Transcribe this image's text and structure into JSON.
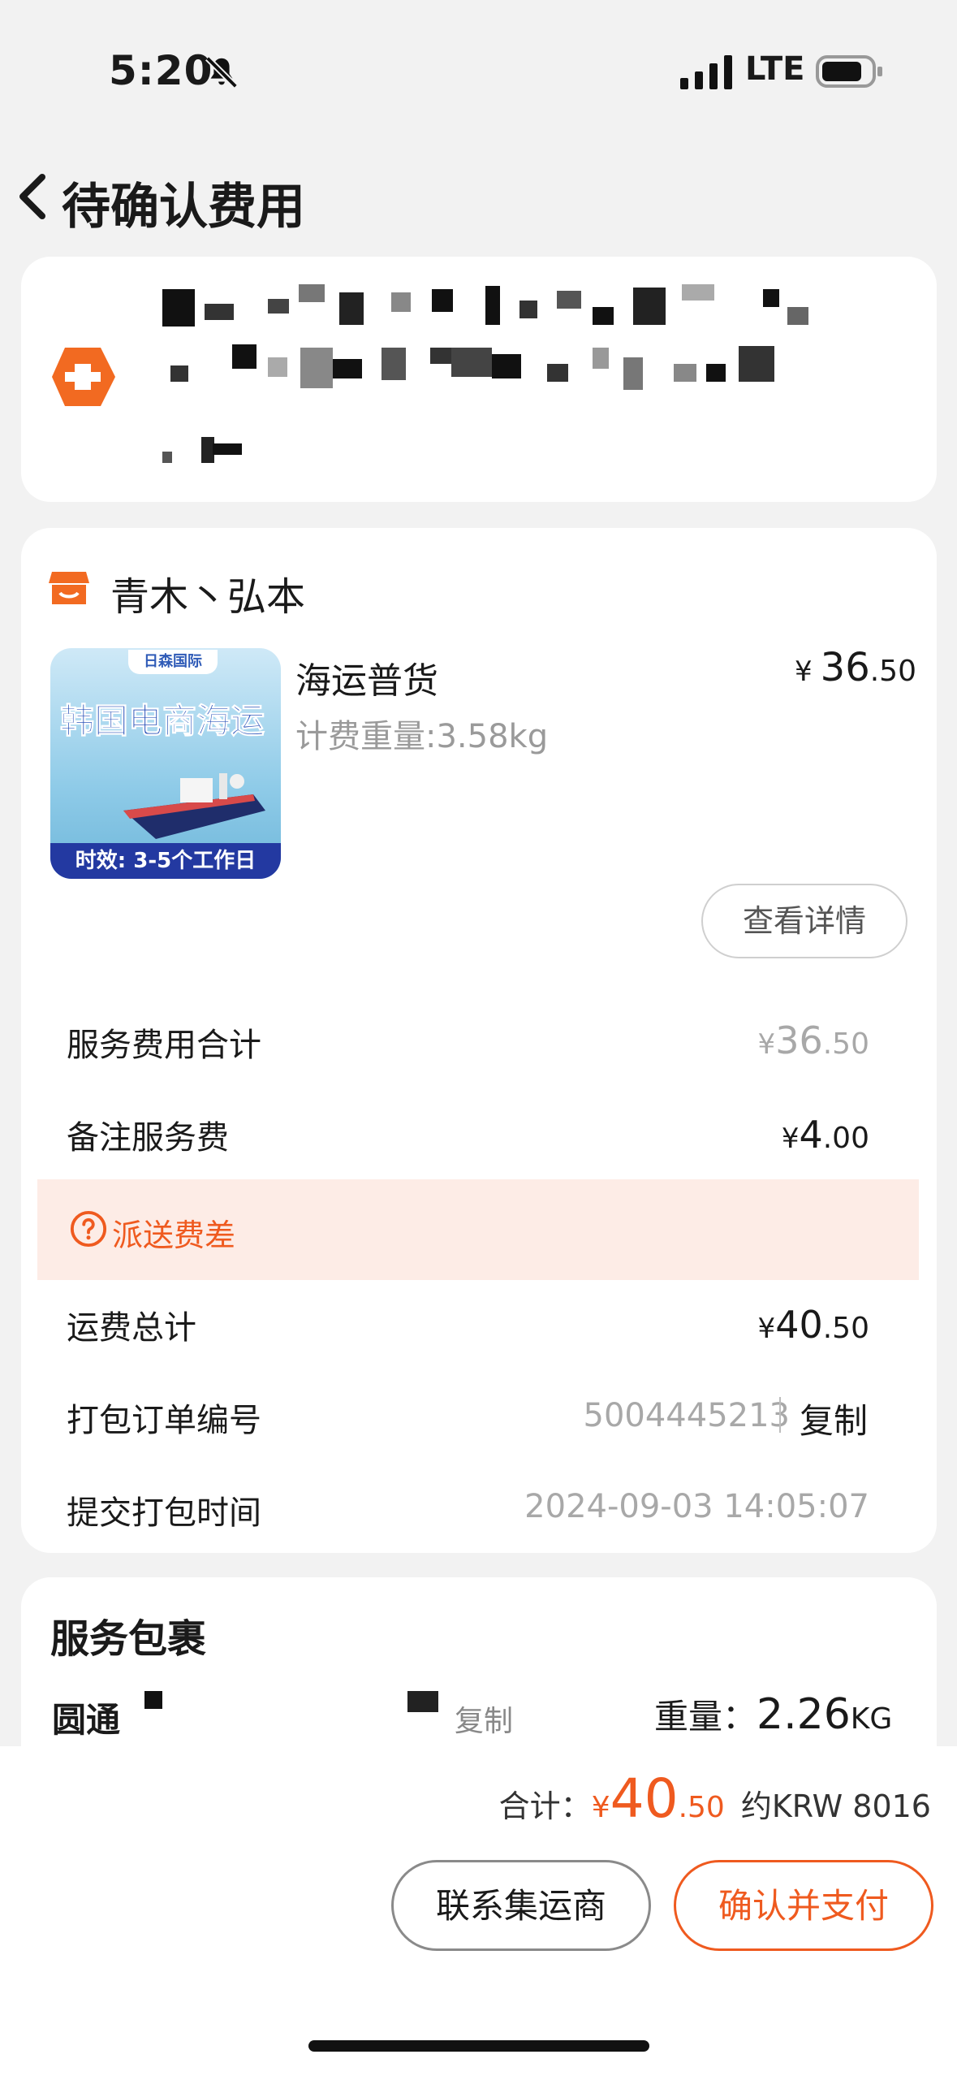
{
  "status_bar": {
    "time": "5:20",
    "network": "LTE"
  },
  "nav": {
    "title": "待确认费用"
  },
  "shop": {
    "name": "青木丶弘本"
  },
  "product": {
    "thumb_logo": "日森国际",
    "thumb_banner": "韩国电商海运",
    "thumb_footer": "时效: 3-5个工作日",
    "name": "海运普货",
    "weight_label": "计费重量:3.58kg",
    "price_currency": "¥",
    "price_int": "36",
    "price_dec": ".50",
    "detail_button": "查看详情"
  },
  "fees": {
    "service_total_label": "服务费用合计",
    "service_total_currency": "¥",
    "service_total_int": "36",
    "service_total_dec": ".50",
    "remark_fee_label": "备注服务费",
    "remark_fee_currency": "¥",
    "remark_fee_int": "4",
    "remark_fee_dec": ".00",
    "delivery_diff_label": "派送费差",
    "freight_total_label": "运费总计",
    "freight_total_currency": "¥",
    "freight_total_int": "40",
    "freight_total_dec": ".50",
    "order_no_label": "打包订单编号",
    "order_no": "5004445213",
    "copy": "复制",
    "submit_time_label": "提交打包时间",
    "submit_time": "2024-09-03 14:05:07"
  },
  "package": {
    "title": "服务包裹",
    "carrier": "圆通",
    "copy": "复制",
    "weight_label": "重量：",
    "weight_value": "2.26",
    "weight_unit": "KG"
  },
  "bottom_bar": {
    "total_label": "合计：",
    "total_currency": "¥",
    "total_int": "40",
    "total_dec": ".50",
    "approx": "约KRW 8016",
    "contact_button": "联系集运商",
    "pay_button": "确认并支付"
  },
  "colors": {
    "accent": "#ef5a1f",
    "warn_bg": "#fdece6",
    "page_bg": "#f2f2f2"
  }
}
